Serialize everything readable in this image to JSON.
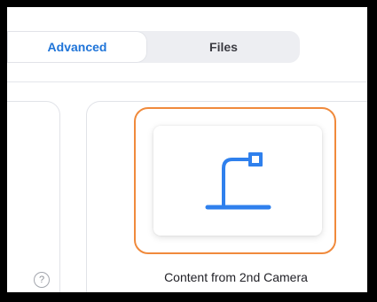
{
  "tabs": [
    {
      "label": "Advanced",
      "active": true
    },
    {
      "label": "Files",
      "active": false
    }
  ],
  "options": {
    "second_camera": {
      "label": "Content from 2nd Camera",
      "icon": "document-camera-icon",
      "selected": true
    }
  },
  "help": {
    "glyph": "?",
    "icon": "help-icon"
  },
  "colors": {
    "accent": "#1f74d8",
    "icon_blue": "#2f80ed",
    "selection_border": "#f08a3c",
    "tab_bar": "#edeef2"
  }
}
